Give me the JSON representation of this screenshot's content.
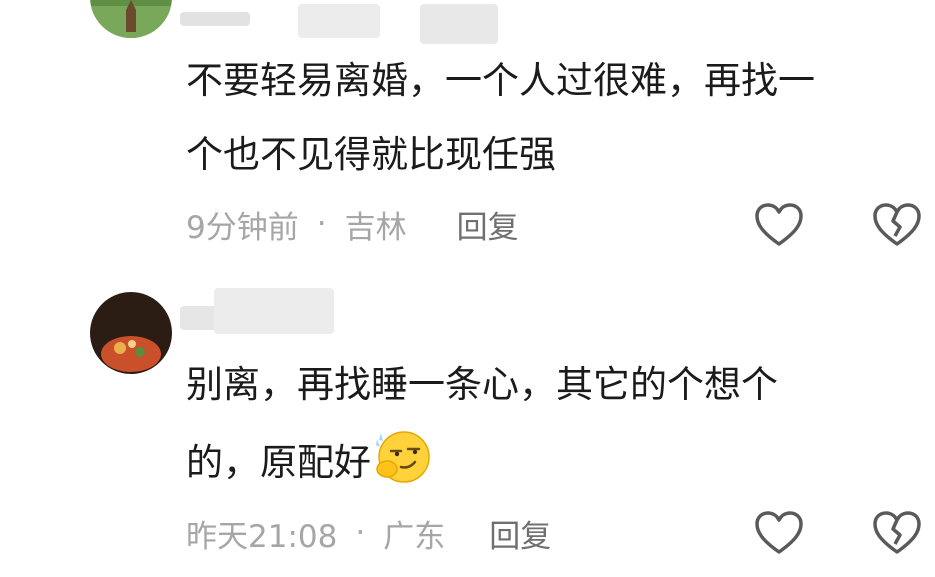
{
  "comments": [
    {
      "text_line1": "不要轻易离婚，一个人过很难，再找一",
      "text_line2": "个也不见得就比现任强",
      "time": "9分钟前",
      "separator": "·",
      "location": "吉林",
      "reply_label": "回复"
    },
    {
      "text_line1": "别离，再找睡一条心，其它的个想个",
      "text_line2": "的，原配好",
      "emoji": "smirk-emoji",
      "time": "昨天21:08",
      "separator": "·",
      "location": "广东",
      "reply_label": "回复"
    }
  ],
  "icons": {
    "like": "heart-outline-icon",
    "dislike": "broken-heart-icon"
  },
  "colors": {
    "text": "#1b1b1b",
    "meta": "#a6a6a6",
    "icon": "#5a5a5a",
    "background": "#ffffff"
  }
}
